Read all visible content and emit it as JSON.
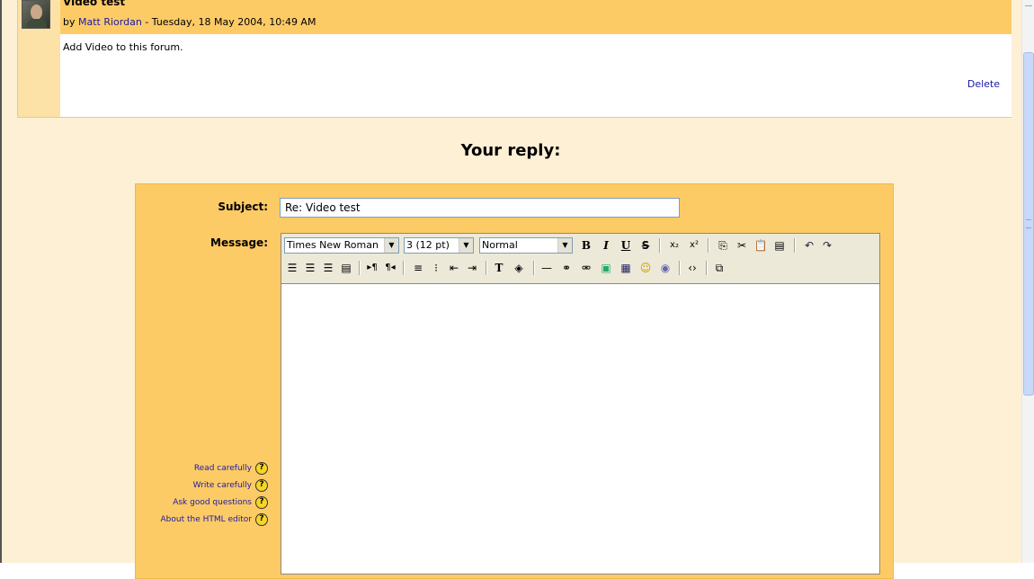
{
  "post": {
    "title": "Video test",
    "by_prefix": "by ",
    "author": "Matt Riordan",
    "date_suffix": " - Tuesday, 18 May 2004, 10:49 AM",
    "message": "Add Video to this forum.",
    "delete_label": "Delete"
  },
  "reply": {
    "heading": "Your reply:",
    "subject_label": "Subject:",
    "subject_value": "Re: Video test",
    "message_label": "Message:"
  },
  "editor": {
    "font_family": "Times New Roman",
    "font_size": "3 (12 pt)",
    "format": "Normal",
    "bold_label": "B",
    "italic_label": "I",
    "underline_label": "U",
    "strike_label": "S",
    "icons": [
      "subscript-icon",
      "superscript-icon",
      "copy-icon",
      "cut-icon",
      "paste-icon",
      "paste-word-icon",
      "undo-icon",
      "redo-icon",
      "align-left-icon",
      "align-center-icon",
      "align-right-icon",
      "justify-icon",
      "ltr-icon",
      "rtl-icon",
      "ordered-list-icon",
      "unordered-list-icon",
      "outdent-icon",
      "indent-icon",
      "text-color-icon",
      "bg-color-icon",
      "horizontal-rule-icon",
      "link-icon",
      "unlink-icon",
      "image-icon",
      "table-icon",
      "smiley-icon",
      "special-char-icon",
      "html-source-icon",
      "fullscreen-icon"
    ]
  },
  "help_links": [
    {
      "label": "Read carefully"
    },
    {
      "label": "Write carefully"
    },
    {
      "label": "Ask good questions"
    },
    {
      "label": "About the HTML editor"
    }
  ],
  "help_icon_glyph": "?",
  "colors": {
    "page_bg": "#fdf0d5",
    "header_bg": "#fdcb66",
    "link": "#1a1aa6"
  }
}
